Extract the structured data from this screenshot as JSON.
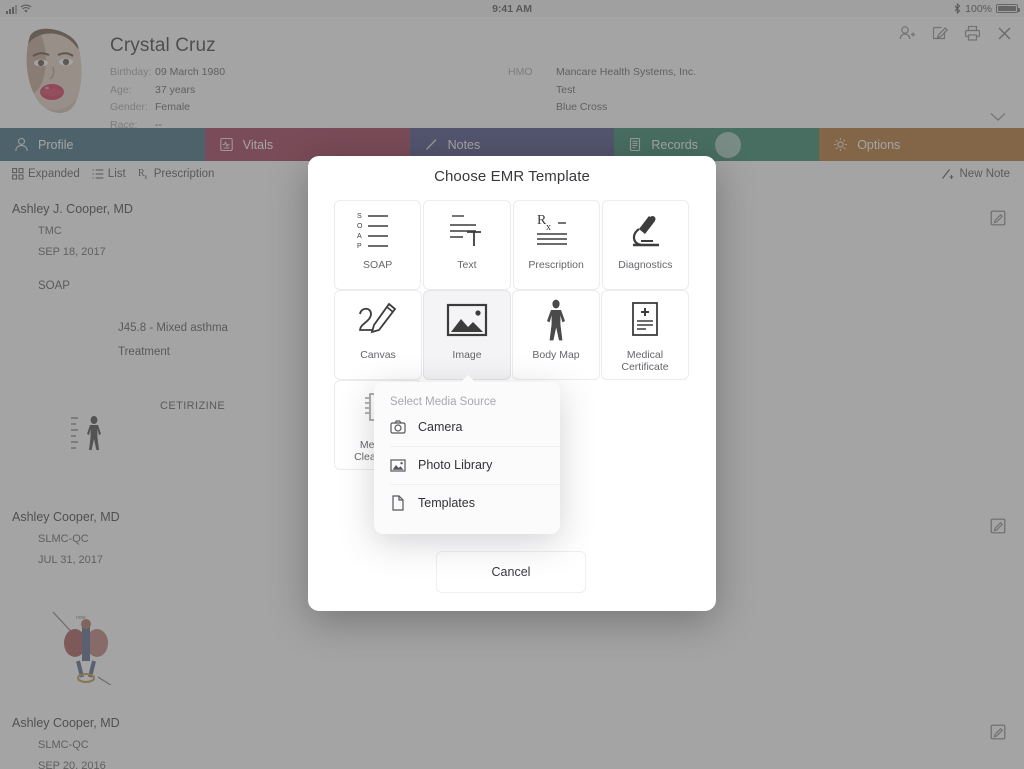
{
  "status_bar": {
    "carrier_icon": "signal-bars-icon",
    "wifi_icon": "wifi-icon",
    "time": "9:41 AM",
    "bluetooth_icon": "bluetooth-icon",
    "battery_percent": "100%"
  },
  "patient": {
    "name": "Crystal Cruz",
    "avatar_name": "patient-avatar",
    "fields": [
      {
        "label": "Birthday:",
        "value": "09 March 1980"
      },
      {
        "label": "Age:",
        "value": "37 years"
      },
      {
        "label": "Gender:",
        "value": "Female"
      },
      {
        "label": "Race:",
        "value": "--"
      }
    ],
    "insurance": {
      "label": "HMO",
      "values": [
        "Mancare Health Systems, Inc.",
        "Test",
        "Blue Cross"
      ]
    },
    "header_actions": [
      "add-patient-icon",
      "edit-icon",
      "print-icon",
      "close-icon"
    ],
    "expand_icon": "chevron-down-icon"
  },
  "tabs": [
    {
      "label": "Profile",
      "icon": "person-icon",
      "color": "#1b5266"
    },
    {
      "label": "Vitals",
      "icon": "monitor-icon",
      "color": "#901637"
    },
    {
      "label": "Notes",
      "icon": "pencil-icon",
      "color": "#2b2f72"
    },
    {
      "label": "Records",
      "icon": "records-icon",
      "color": "#0e7150",
      "has_badge": true
    },
    {
      "label": "Options",
      "icon": "gear-icon",
      "color": "#a85c0b"
    }
  ],
  "notes_toolbar": {
    "views": [
      {
        "label": "Expanded",
        "icon": "grid-icon"
      },
      {
        "label": "List",
        "icon": "list-icon"
      },
      {
        "label": "Prescription",
        "icon": "rx-icon"
      }
    ],
    "new_note": {
      "label": "New Note",
      "icon": "pencil-plus-icon"
    }
  },
  "notes": [
    {
      "doctor": "Ashley J. Cooper, MD",
      "facility": "TMC",
      "date": "SEP 18, 2017",
      "kind": "SOAP",
      "diagnosis": "J45.8 - Mixed asthma",
      "treatment": "Treatment",
      "medication": "CETIRIZINE",
      "thumb": "body-map-thumbnail",
      "edit_icon": "edit-note-icon"
    },
    {
      "doctor": "Ashley Cooper, MD",
      "facility": "SLMC-QC",
      "date": "JUL 31, 2017",
      "thumb": "lungs-sketch-thumbnail",
      "edit_icon": "edit-note-icon"
    },
    {
      "doctor": "Ashley Cooper, MD",
      "facility": "SLMC-QC",
      "date": "SEP 20, 2016",
      "edit_icon": "edit-note-icon"
    }
  ],
  "modal": {
    "title": "Choose EMR Template",
    "templates": [
      {
        "label": "SOAP",
        "icon": "soap-lines-icon",
        "selected": false
      },
      {
        "label": "Text",
        "icon": "text-lines-icon",
        "selected": false
      },
      {
        "label": "Prescription",
        "icon": "rx-pad-icon",
        "selected": false
      },
      {
        "label": "Diagnostics",
        "icon": "microscope-icon",
        "selected": false
      },
      {
        "label": "Canvas",
        "icon": "pen-draw-icon",
        "selected": false
      },
      {
        "label": "Image",
        "icon": "picture-icon",
        "selected": true
      },
      {
        "label": "Body Map",
        "icon": "body-figure-icon",
        "selected": false
      },
      {
        "label": "Medical Certificate",
        "icon": "certificate-icon",
        "selected": false
      },
      {
        "label": "Medical Clearance",
        "icon": "clearance-icon",
        "selected": false
      }
    ],
    "cancel_label": "Cancel"
  },
  "popover": {
    "title": "Select Media Source",
    "items": [
      {
        "label": "Camera",
        "icon": "camera-icon"
      },
      {
        "label": "Photo Library",
        "icon": "photo-library-icon"
      },
      {
        "label": "Templates",
        "icon": "document-icon"
      }
    ]
  }
}
